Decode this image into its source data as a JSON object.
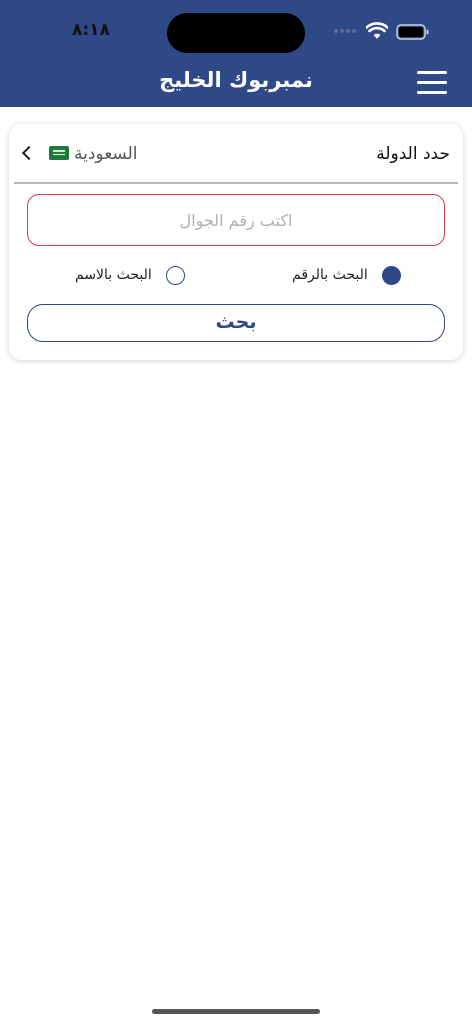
{
  "status_bar": {
    "time": "٨:١٨"
  },
  "header": {
    "title": "نمبربوك الخليج"
  },
  "form": {
    "country_label": "حدد الدولة",
    "country_value": "السعودية",
    "phone_placeholder": "اكتب رقم الجوال",
    "radio_by_number": "البحث بالرقم",
    "radio_by_name": "البحث بالاسم",
    "selected_mode": "by_number",
    "search_button": "بحث"
  },
  "colors": {
    "primary": "#2f4886",
    "input_border": "#d73a3a"
  },
  "icons": [
    "menu-icon",
    "chevron-left-icon",
    "saudi-flag-icon",
    "wifi-icon",
    "battery-icon"
  ]
}
